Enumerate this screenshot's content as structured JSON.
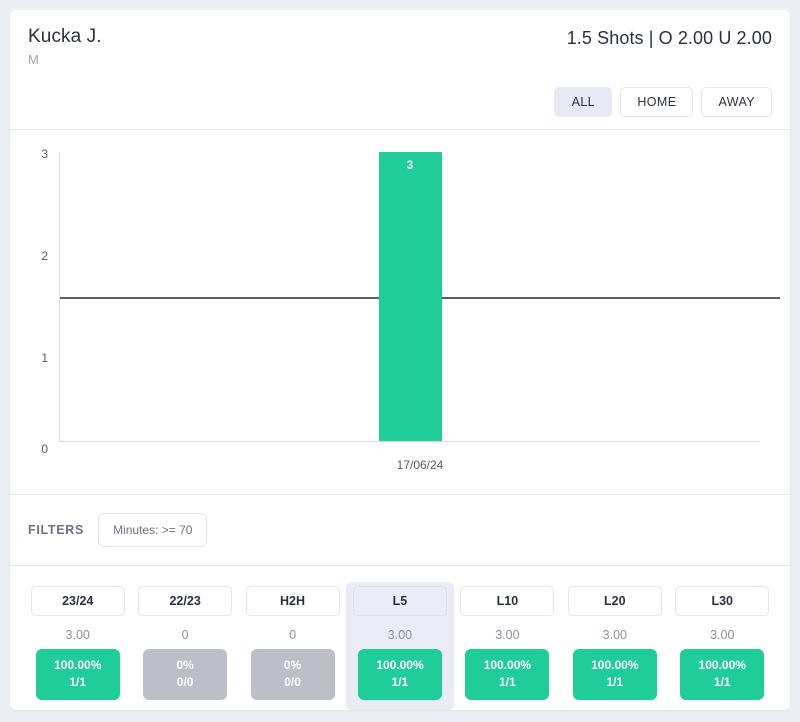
{
  "header": {
    "player_name": "Kucka J.",
    "player_position": "M",
    "market_line": "1.5 Shots | O 2.00 U 2.00",
    "venue_filters": [
      {
        "label": "ALL",
        "active": true
      },
      {
        "label": "HOME",
        "active": false
      },
      {
        "label": "AWAY",
        "active": false
      }
    ]
  },
  "filters": {
    "title": "FILTERS",
    "chips": [
      {
        "label": "Minutes: >= 70"
      }
    ]
  },
  "chart_data": {
    "type": "bar",
    "title": "",
    "xlabel": "",
    "ylabel": "",
    "categories": [
      "17/06/24"
    ],
    "values": [
      3
    ],
    "bar_labels": [
      "3"
    ],
    "ylim": [
      0,
      3
    ],
    "yticks": [
      "3",
      "2",
      "1",
      "0"
    ],
    "threshold": 1.5,
    "threshold_color": "#5b5f6e",
    "bar_color": "#1ecd97",
    "grid": false,
    "legend": "none"
  },
  "stats": {
    "columns": [
      {
        "period": "23/24",
        "average": "3.00",
        "percent": "100.00%",
        "record": "1/1",
        "badge_style": "green",
        "active": false
      },
      {
        "period": "22/23",
        "average": "0",
        "percent": "0%",
        "record": "0/0",
        "badge_style": "gray",
        "active": false
      },
      {
        "period": "H2H",
        "average": "0",
        "percent": "0%",
        "record": "0/0",
        "badge_style": "gray",
        "active": false
      },
      {
        "period": "L5",
        "average": "3.00",
        "percent": "100.00%",
        "record": "1/1",
        "badge_style": "green",
        "active": true
      },
      {
        "period": "L10",
        "average": "3.00",
        "percent": "100.00%",
        "record": "1/1",
        "badge_style": "green",
        "active": false
      },
      {
        "period": "L20",
        "average": "3.00",
        "percent": "100.00%",
        "record": "1/1",
        "badge_style": "green",
        "active": false
      },
      {
        "period": "L30",
        "average": "3.00",
        "percent": "100.00%",
        "record": "1/1",
        "badge_style": "green",
        "active": false
      }
    ]
  },
  "colors": {
    "accent_green": "#1ecd97",
    "muted_gray": "#bcbec8",
    "active_highlight": "#e9ebf5",
    "page_background": "#eceef5"
  }
}
